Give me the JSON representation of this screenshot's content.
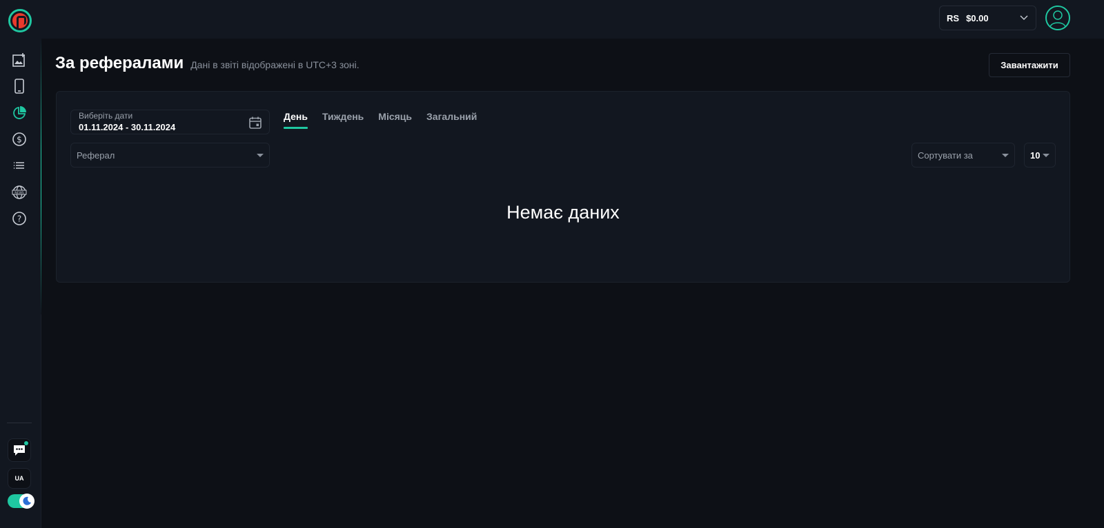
{
  "header": {
    "currency_code": "RS",
    "balance": "$0.00"
  },
  "sidebar": {
    "items": [
      {
        "icon": "add-image-icon"
      },
      {
        "icon": "mobile-icon"
      },
      {
        "icon": "pie-chart-icon"
      },
      {
        "icon": "dollar-icon"
      },
      {
        "icon": "list-icon"
      },
      {
        "icon": "news-globe-icon"
      },
      {
        "icon": "help-icon"
      }
    ],
    "language": "UA"
  },
  "page": {
    "title": "За рефералами",
    "subtitle": "Дані в звіті відображені в UTC+3 зоні.",
    "download_label": "Завантажити"
  },
  "filters": {
    "date_label": "Виберіть дати",
    "date_value": "01.11.2024 - 30.11.2024",
    "tabs": [
      {
        "label": "День",
        "active": true
      },
      {
        "label": "Тиждень",
        "active": false
      },
      {
        "label": "Місяць",
        "active": false
      },
      {
        "label": "Загальний",
        "active": false
      }
    ],
    "referral_placeholder": "Реферал",
    "sort_placeholder": "Сортувати за",
    "page_size": "10"
  },
  "empty_message": "Немає даних",
  "colors": {
    "accent": "#1fc7a1",
    "background": "#0d1016",
    "panel": "#121720",
    "logo_red": "#e8392c"
  }
}
